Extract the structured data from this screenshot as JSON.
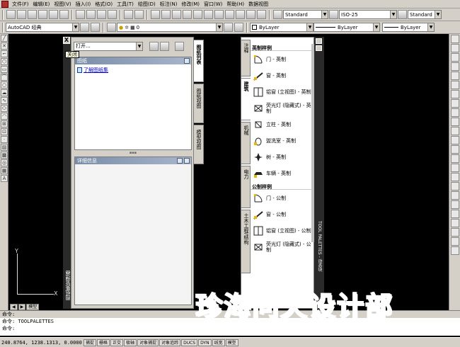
{
  "menu": [
    "文件(F)",
    "编辑(E)",
    "视图(V)",
    "插入(I)",
    "格式(O)",
    "工具(T)",
    "绘图(D)",
    "标注(N)",
    "修改(M)",
    "窗口(W)",
    "帮助(H)",
    "数据视图"
  ],
  "toolbar": {
    "text_style": "Standard",
    "dim_style": "ISO-25",
    "table_style": "Standard",
    "workspace": "AutoCAD 经典",
    "layer": "0",
    "color": "ByLayer",
    "linetype": "ByLayer",
    "lineweight": "ByLayer"
  },
  "design_center": {
    "close_label": "X",
    "close_tooltip": "关闭",
    "open_combo": "打开...",
    "section_tree": "图纸",
    "link_text": "了解图纸集",
    "section_details": "详细信息",
    "panel_title": "图纸集管理器",
    "tabs": [
      "图纸列表",
      "图纸视图",
      "模型视图"
    ]
  },
  "tool_palettes": {
    "side_title": "TOOL PALETTES - 动态块",
    "tabs": [
      "注释",
      "建筑",
      "机械",
      "电力",
      "土木工程/结构"
    ],
    "group1": "英制样例",
    "group2": "公制样例",
    "tools_imperial": [
      "门 - 英制",
      "窗 - 英制",
      "铝窗 (立视图) - 英制",
      "荧光灯 (隐藏式) - 英制",
      "立柱 - 英制",
      "盥洗室 - 英制",
      "树 - 英制",
      "车辆 - 英制"
    ],
    "tools_metric": [
      "门 - 公制",
      "窗 - 公制",
      "铝窗 (立视图) - 公制",
      "荧光灯 (隐藏式) - 公制"
    ]
  },
  "canvas": {
    "ucs_y": "Y",
    "ucs_x": "X",
    "tab_model": "模型"
  },
  "command": {
    "line1": "命令:",
    "line2": "命令:  TOOLPALETTES",
    "line3": "命令:"
  },
  "watermark": "珍海问天设计部",
  "status": {
    "coords": "240.8764, 1238.1313, 0.0000",
    "buttons": [
      "捕捉",
      "栅格",
      "正交",
      "极轴",
      "对象捕捉",
      "对象追踪",
      "DUCS",
      "DYN",
      "线宽",
      "模型"
    ]
  },
  "colors": {
    "panel": "#d4d0c8",
    "canvas": "#000000",
    "link": "#0000cc",
    "watermark": "#1a3fcc"
  }
}
